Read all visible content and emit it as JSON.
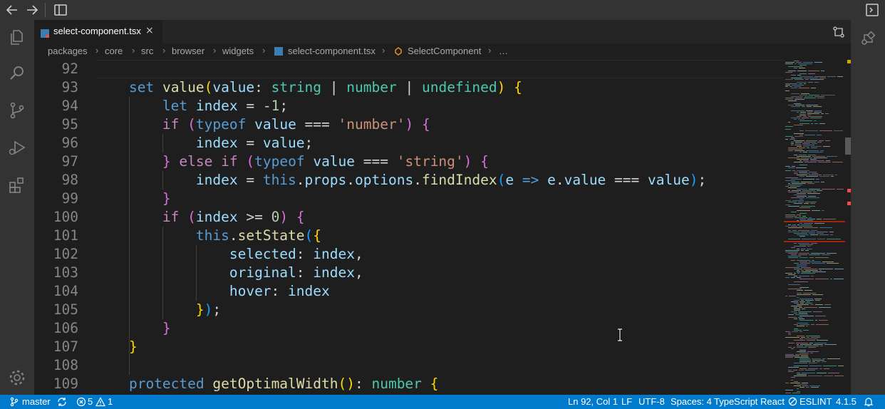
{
  "titlebar": {
    "back_icon": "arrow-left-icon",
    "forward_icon": "arrow-right-icon",
    "layout_icon": "toggle-sidebar-icon"
  },
  "activity": [
    "explorer-icon",
    "search-icon",
    "source-control-icon",
    "run-debug-icon",
    "extensions-icon",
    "settings-gear-icon"
  ],
  "tab": {
    "label": "select-component.tsx",
    "close": "×"
  },
  "breadcrumb": {
    "items": [
      "packages",
      "core",
      "src",
      "browser",
      "widgets",
      "select-component.tsx",
      "SelectComponent",
      "…"
    ]
  },
  "editor": {
    "line_numbers": [
      "92",
      "93",
      "94",
      "95",
      "96",
      "97",
      "98",
      "99",
      "100",
      "101",
      "102",
      "103",
      "104",
      "105",
      "106",
      "107",
      "108",
      "109"
    ]
  },
  "statusbar": {
    "branch": "master",
    "errors": "5",
    "warnings": "1",
    "position": "Ln 92, Col 1",
    "eol": "LF",
    "encoding": "UTF-8",
    "indent": "Spaces: 4",
    "language": "TypeScript React",
    "eslint": "ESLINT",
    "version": "4.1.5"
  },
  "colors": {
    "statusbar_bg": "#007acc",
    "editor_bg": "#1e1e1e",
    "keyword": "#569cd6",
    "control": "#c586c0",
    "function": "#dcdcaa",
    "type": "#4ec9b0",
    "string": "#ce9178",
    "number": "#b5cea8"
  }
}
